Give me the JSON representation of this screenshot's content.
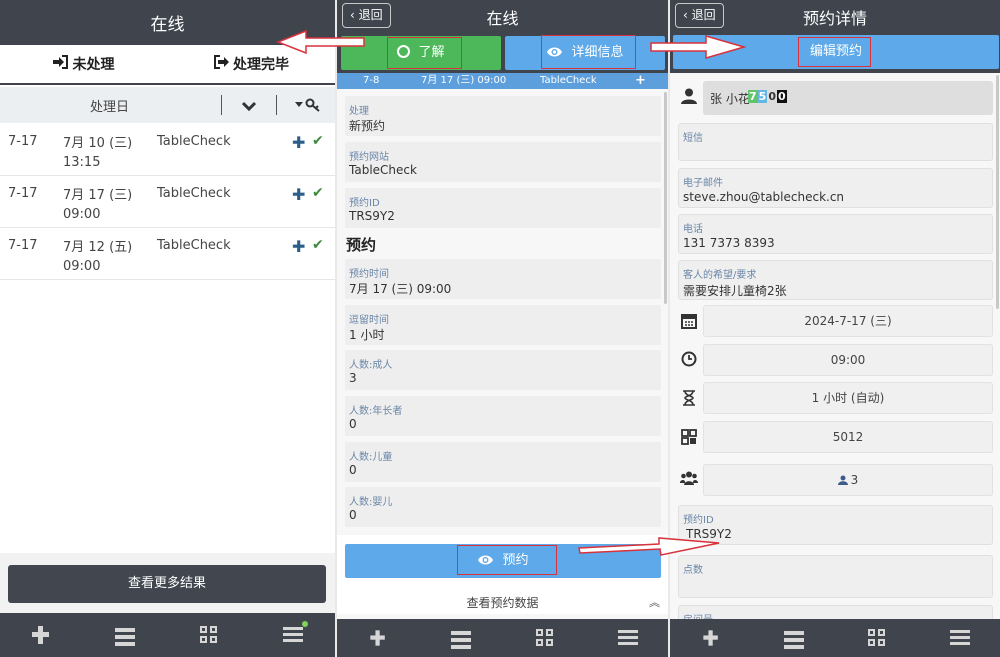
{
  "panel1": {
    "title": "在线",
    "tabs": [
      {
        "label": "未处理",
        "icon": "sign-in-icon"
      },
      {
        "label": "处理完毕",
        "icon": "sign-out-icon"
      }
    ],
    "table_header": "处理日",
    "rows": [
      {
        "day": "7-17",
        "date": "7月 10 (三)",
        "time": "13:15",
        "source": "TableCheck"
      },
      {
        "day": "7-17",
        "date": "7月 17 (三)",
        "time": "09:00",
        "source": "TableCheck"
      },
      {
        "day": "7-17",
        "date": "7月 12 (五)",
        "time": "09:00",
        "source": "TableCheck"
      }
    ],
    "more_button": "查看更多结果"
  },
  "panel2": {
    "back": "退回",
    "title": "在线",
    "ack_button": "了解",
    "details_button": "详细信息",
    "strip": {
      "date": "7-8",
      "datetime": "7月 17 (三) 09:00",
      "source": "TableCheck"
    },
    "fields_top": [
      {
        "label": "处理",
        "value": "新预约"
      },
      {
        "label": "预约网站",
        "value": "TableCheck"
      },
      {
        "label": "预约ID",
        "value": "TRS9Y2"
      }
    ],
    "section_title": "预约",
    "fields_bottom": [
      {
        "label": "预约时间",
        "value": "7月 17 (三) 09:00"
      },
      {
        "label": "逗留时间",
        "value": "1 小时"
      },
      {
        "label": "人数:成人",
        "value": "3"
      },
      {
        "label": "人数:年长者",
        "value": "0"
      },
      {
        "label": "人数:儿童",
        "value": "0"
      },
      {
        "label": "人数:婴儿",
        "value": "0"
      }
    ],
    "reserve_button": "预约",
    "view_data_link": "查看预约数据"
  },
  "panel3": {
    "back": "退回",
    "title": "预约详情",
    "edit_button": "编辑预约",
    "guest_name": "张 小花",
    "badges": [
      "7",
      "5",
      "0",
      "0"
    ],
    "fields": [
      {
        "label": "短信",
        "value": ""
      },
      {
        "label": "电子邮件",
        "value": "steve.zhou@tablecheck.cn"
      },
      {
        "label": "电话",
        "value": "131 7373 8393"
      },
      {
        "label": "客人的希望/要求",
        "value": "需要安排儿童椅2张"
      }
    ],
    "date": "2024-7-17 (三)",
    "time": "09:00",
    "duration": "1 小时 (自动)",
    "table": "5012",
    "party": "3",
    "reservation_id_label": "预约ID",
    "reservation_id": "TRS9Y2",
    "points_label": "点数",
    "room_label": "房间号"
  },
  "colors": {
    "dark_bar": "#3f444d",
    "green_button": "#4cb85a",
    "blue_button": "#5ea9e9",
    "annotation_red": "#d8323c"
  }
}
